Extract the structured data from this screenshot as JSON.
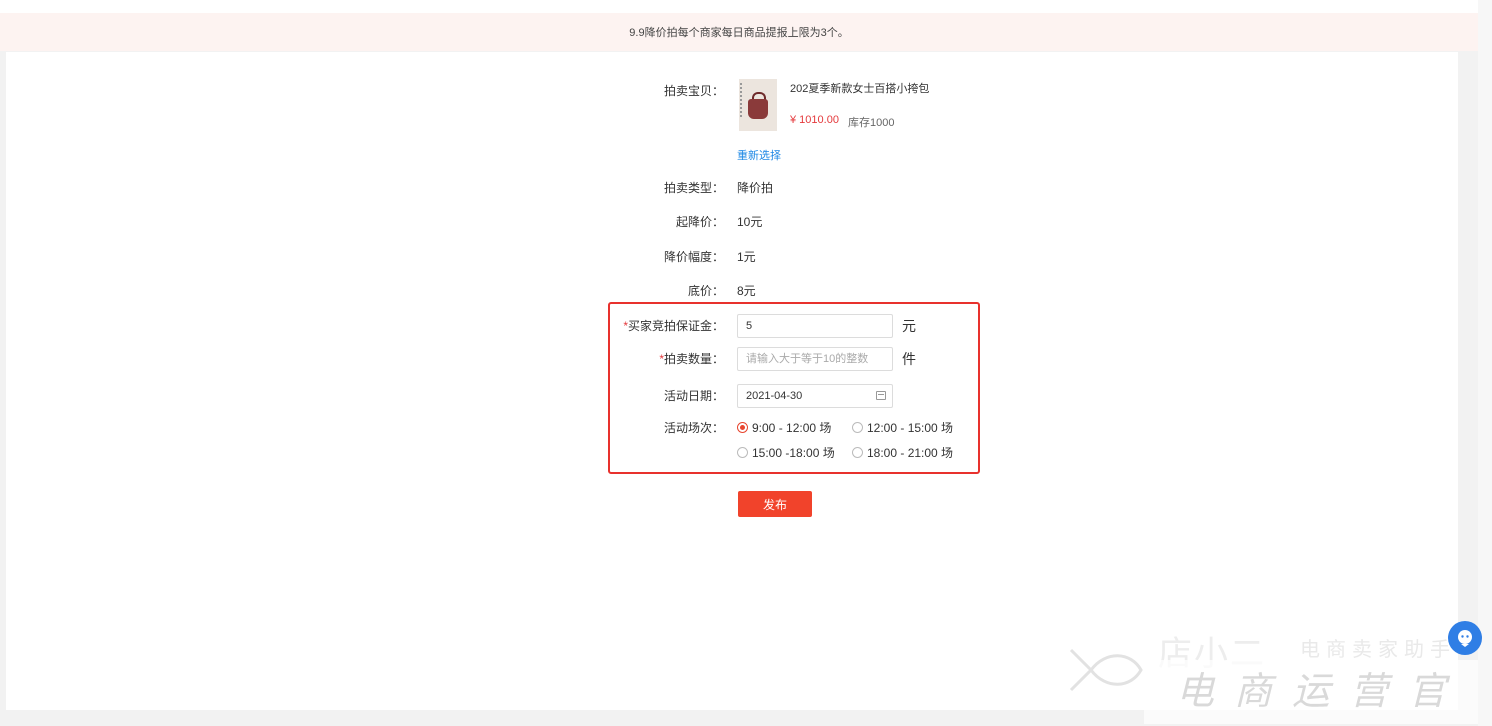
{
  "notice": "9.9降价拍每个商家每日商品提报上限为3个。",
  "product": {
    "label": "拍卖宝贝：",
    "title": "202夏季新款女士百搭小挎包",
    "price": "¥ 1010.00",
    "stock": "库存1000",
    "reselect": "重新选择"
  },
  "info_rows": [
    {
      "label": "拍卖类型：",
      "value": "降价拍"
    },
    {
      "label": "起降价：",
      "value": "10元"
    },
    {
      "label": "降价幅度：",
      "value": "1元"
    },
    {
      "label": "底价：",
      "value": "8元"
    }
  ],
  "form": {
    "deposit": {
      "required_mark": "*",
      "label": "买家竞拍保证金：",
      "value": "5",
      "unit": "元"
    },
    "quantity": {
      "required_mark": "*",
      "label": "拍卖数量：",
      "placeholder": "请输入大于等于10的整数",
      "unit": "件"
    },
    "date": {
      "label": "活动日期：",
      "value": "2021-04-30"
    },
    "session": {
      "label": "活动场次：",
      "options": [
        {
          "label": "9:00 - 12:00 场",
          "selected": true
        },
        {
          "label": "12:00 - 15:00 场",
          "selected": false
        },
        {
          "label": "15:00 -18:00 场",
          "selected": false
        },
        {
          "label": "18:00 - 21:00 场",
          "selected": false
        }
      ]
    }
  },
  "publish_label": "发布",
  "watermark": {
    "line1": "店小二",
    "line2": "电商卖家助手",
    "line3": "电商运营官"
  },
  "colors": {
    "accent": "#f1432b",
    "link": "#1e88e5",
    "highlight_box": "#e8312d",
    "chat": "#2f7ee5"
  }
}
